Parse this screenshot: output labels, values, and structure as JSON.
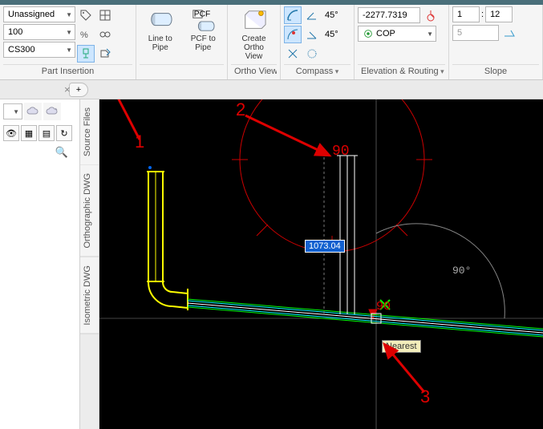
{
  "ribbon": {
    "part_insertion": {
      "caption": "Part Insertion",
      "assignment_dd": "Unassigned",
      "size_dd": "100",
      "spec_dd": "CS300"
    },
    "line_to_pipe": {
      "label": "Line to\nPipe"
    },
    "pcf_to_pipe": {
      "label": "PCF to\nPipe"
    },
    "ortho_views": {
      "caption": "Ortho Views",
      "create": "Create\nOrtho View"
    },
    "compass": {
      "caption": "Compass",
      "angle1": "45°",
      "angle2": "45°"
    },
    "elevation": {
      "caption": "Elevation & Routing",
      "value": "-2277.7319",
      "cop": "COP"
    },
    "slope": {
      "caption": "Slope",
      "a": "1",
      "sep": ":",
      "b": "12",
      "c": "5"
    }
  },
  "sidetabs": {
    "source": "Source Files",
    "ortho": "Orthographic DWG",
    "iso": "Isometric DWG"
  },
  "canvas": {
    "dim": "1073.04",
    "ang_main": "90",
    "ang_small": "90",
    "ang_gray": "90°",
    "snap": "Nearest"
  },
  "annotations": {
    "a1": "1",
    "a2": "2",
    "a3": "3"
  }
}
